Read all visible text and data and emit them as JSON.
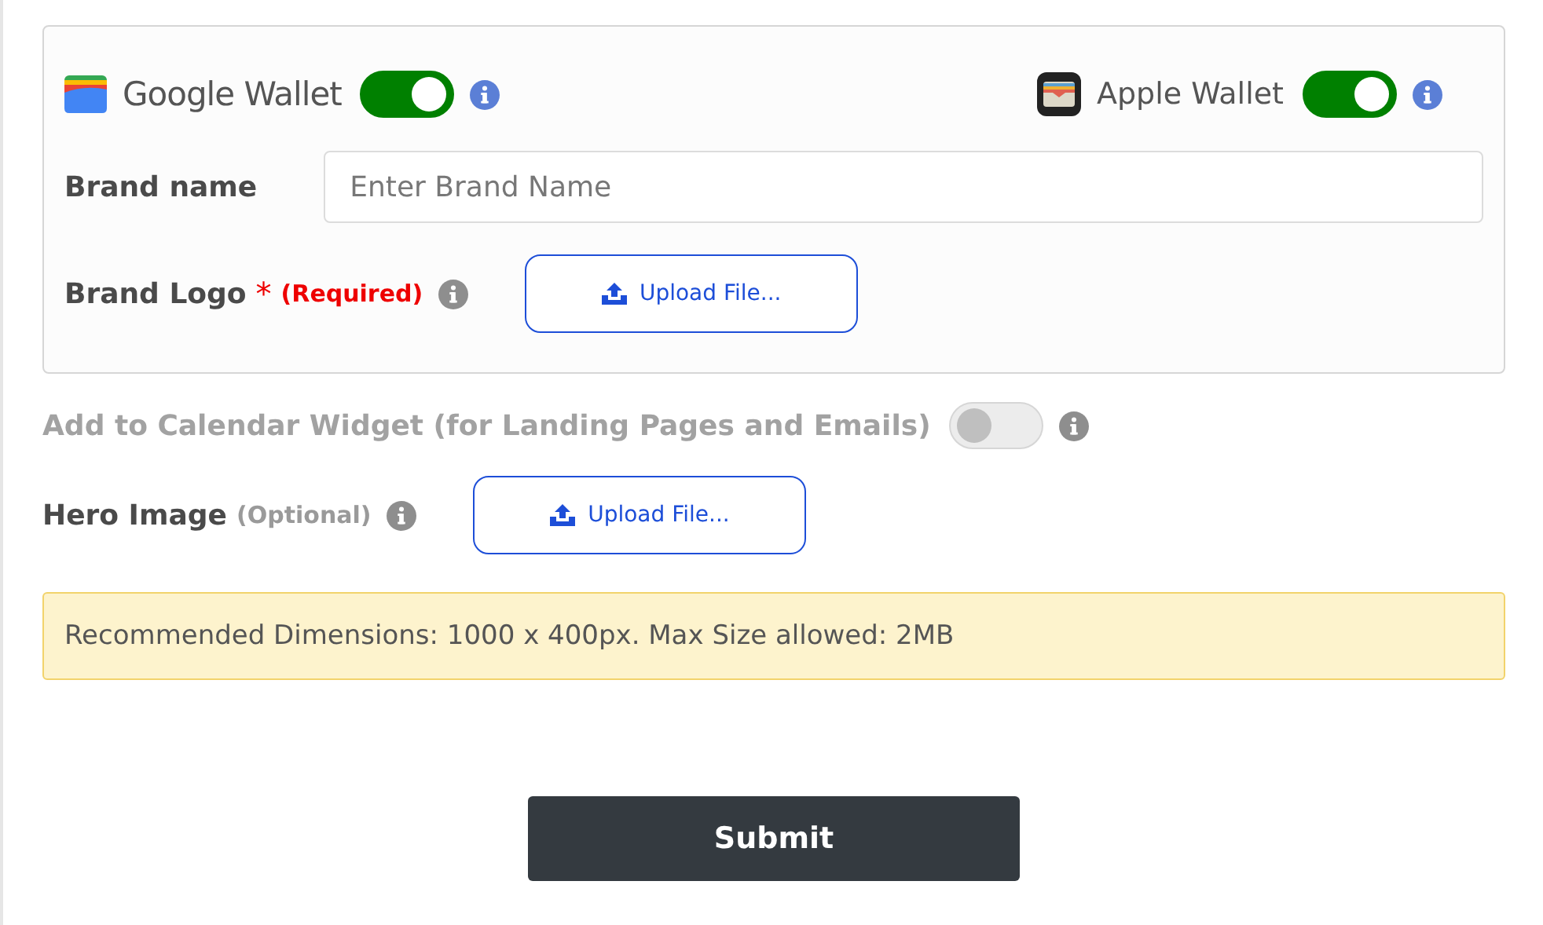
{
  "wallets": [
    {
      "kind": "google",
      "label": "Google Wallet",
      "on": true
    },
    {
      "kind": "apple",
      "label": "Apple Wallet",
      "on": true
    }
  ],
  "brand_name": {
    "label": "Brand name",
    "placeholder": "Enter Brand Name"
  },
  "brand_logo": {
    "label": "Brand Logo",
    "required_mark": "*",
    "note": "(Required)",
    "button": "Upload File..."
  },
  "calendar_widget": {
    "label": "Add to Calendar Widget (for Landing Pages and Emails)",
    "on": false,
    "disabled": true
  },
  "hero_image": {
    "label": "Hero Image",
    "note": "(Optional)",
    "button": "Upload File..."
  },
  "notice": "Recommended Dimensions: 1000 x 400px. Max Size allowed: 2MB",
  "submit": "Submit"
}
